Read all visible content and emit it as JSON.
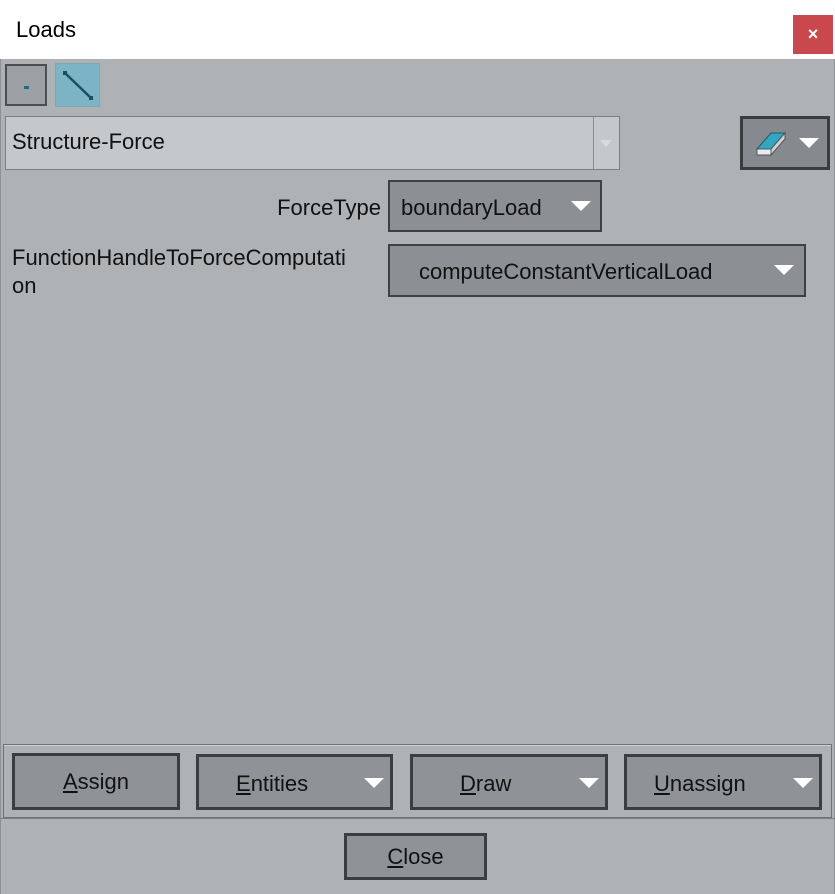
{
  "window": {
    "title": "Loads",
    "close_glyph": "×"
  },
  "toolbar": {
    "items": [
      {
        "icon": "point-icon",
        "active": false
      },
      {
        "icon": "line-icon",
        "active": true
      }
    ]
  },
  "condition_select": {
    "value": "Structure-Force"
  },
  "fields": [
    {
      "label": "ForceType",
      "value": "boundaryLoad"
    },
    {
      "label": "FunctionHandleToForceComputati\non",
      "value": "computeConstantVerticalLoad"
    }
  ],
  "actions": {
    "assign": {
      "mnemonic": "A",
      "rest": "ssign"
    },
    "entities": {
      "mnemonic": "E",
      "rest": "ntities"
    },
    "draw": {
      "mnemonic": "D",
      "rest": "raw"
    },
    "unassign": {
      "mnemonic": "U",
      "rest": "nassign"
    },
    "close": {
      "mnemonic": "C",
      "rest": "lose"
    }
  },
  "colors": {
    "background": "#afb2b5",
    "close_button": "#c9484d",
    "active_tool": "#7cb4c6"
  }
}
